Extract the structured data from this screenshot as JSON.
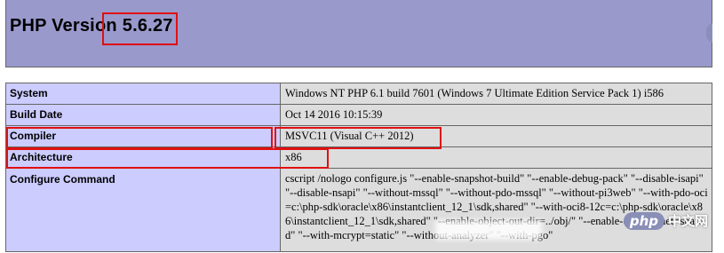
{
  "header": {
    "title_prefix": "PHP Version",
    "version": "5.6.27"
  },
  "rows": [
    {
      "key": "System",
      "value": "Windows NT PHP 6.1 build 7601 (Windows 7 Ultimate Edition Service Pack 1) i586"
    },
    {
      "key": "Build Date",
      "value": "Oct 14 2016 10:15:39"
    },
    {
      "key": "Compiler",
      "value": "MSVC11 (Visual C++ 2012)"
    },
    {
      "key": "Architecture",
      "value": "x86"
    },
    {
      "key": "Configure Command",
      "value": "cscript /nologo configure.js \"--enable-snapshot-build\" \"--enable-debug-pack\" \"--disable-isapi\" \"--disable-nsapi\" \"--without-mssql\" \"--without-pdo-mssql\" \"--without-pi3web\" \"--with-pdo-oci=c:\\php-sdk\\oracle\\x86\\instantclient_12_1\\sdk,shared\" \"--with-oci8-12c=c:\\php-sdk\\oracle\\x86\\instantclient_12_1\\sdk,shared\" \"--enable-object-out-dir=../obj/\" \"--enable-com-dotnet=shared\" \"--with-mcrypt=static\" \"--without-analyzer\" \"--with-pgo\""
    }
  ],
  "watermark": {
    "badge": "php",
    "text": "中文网"
  },
  "colors": {
    "header_bg": "#9999cc",
    "key_bg": "#ccccff",
    "value_bg": "#dddddd",
    "highlight": "#e01010"
  }
}
